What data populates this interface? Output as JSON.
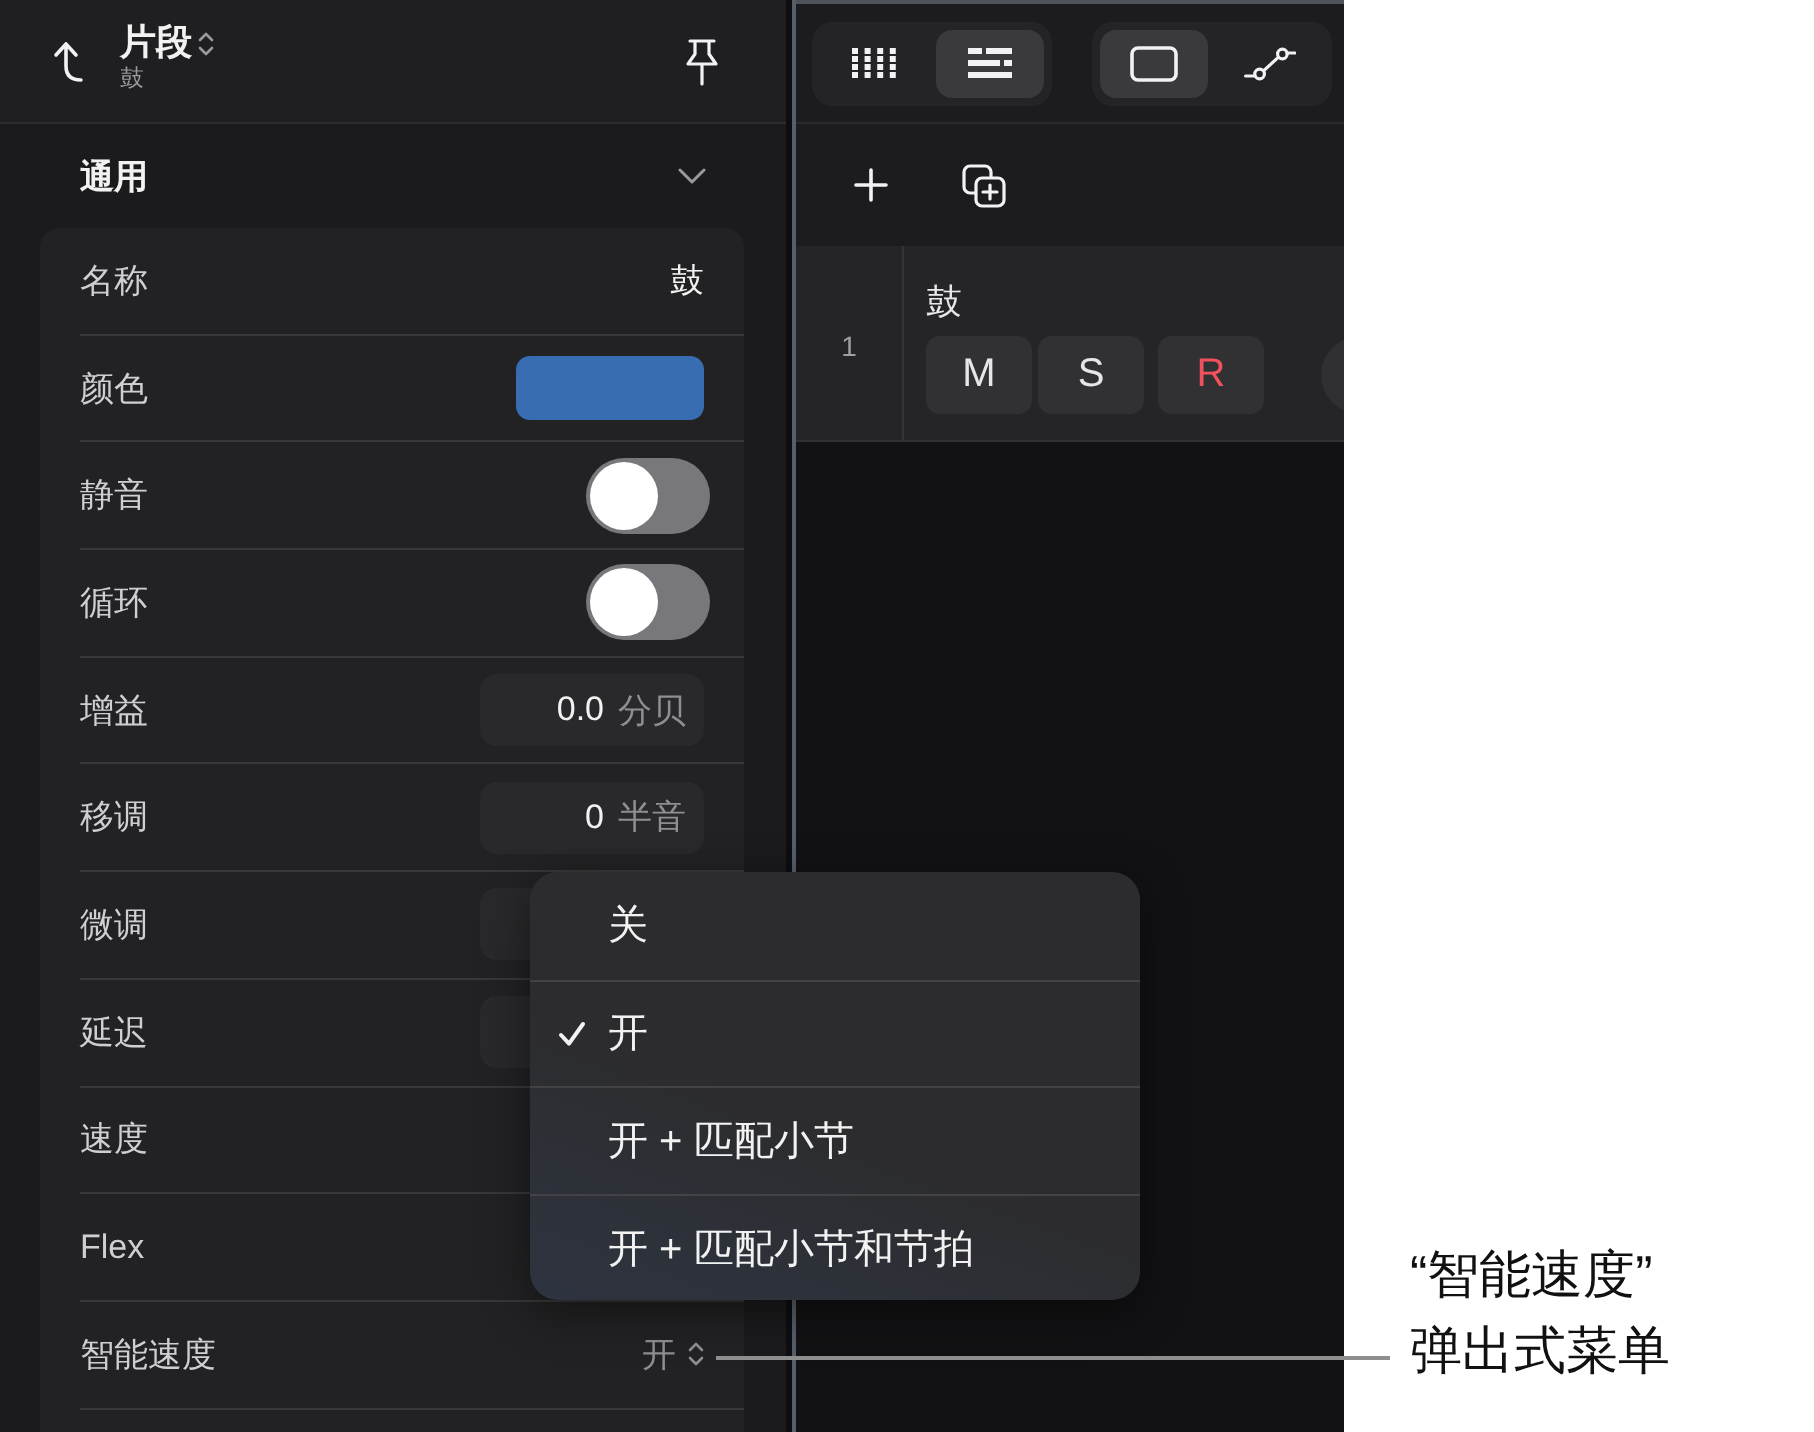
{
  "inspector": {
    "title": "片段",
    "subtitle": "鼓",
    "section": {
      "title": "通用",
      "expanded": true
    },
    "rows": [
      {
        "kind": "text",
        "label": "名称",
        "value": "鼓"
      },
      {
        "kind": "color",
        "label": "颜色",
        "color": "#386db1"
      },
      {
        "kind": "toggle",
        "label": "静音",
        "on": false
      },
      {
        "kind": "toggle",
        "label": "循环",
        "on": false
      },
      {
        "kind": "number",
        "label": "增益",
        "value": "0.0",
        "unit": "分贝"
      },
      {
        "kind": "number",
        "label": "移调",
        "value": "0",
        "unit": "半音"
      },
      {
        "kind": "number",
        "label": "微调"
      },
      {
        "kind": "number",
        "label": "延迟"
      },
      {
        "kind": "plain",
        "label": "速度"
      },
      {
        "kind": "plain",
        "label": "Flex"
      },
      {
        "kind": "popup",
        "label": "智能速度",
        "value": "开"
      }
    ]
  },
  "popup_menu": {
    "items": [
      {
        "label": "关",
        "selected": false
      },
      {
        "label": "开",
        "selected": true
      },
      {
        "label": "开 + 匹配小节",
        "selected": false
      },
      {
        "label": "开 + 匹配小节和节拍",
        "selected": false
      }
    ]
  },
  "track_panel": {
    "view_buttons": [
      {
        "kind": "grid",
        "selected": false
      },
      {
        "kind": "list",
        "selected": true
      }
    ],
    "mode_buttons": [
      {
        "kind": "region",
        "selected": true
      },
      {
        "kind": "automation",
        "selected": false
      }
    ],
    "tools": [
      {
        "kind": "add"
      },
      {
        "kind": "duplicate"
      }
    ],
    "track": {
      "number": "1",
      "name": "鼓",
      "buttons": [
        {
          "kind": "mute",
          "label": "M"
        },
        {
          "kind": "solo",
          "label": "S"
        },
        {
          "kind": "record",
          "label": "R"
        }
      ]
    }
  },
  "callout": {
    "lines": [
      "“智能速度”",
      "弹出式菜单"
    ]
  }
}
